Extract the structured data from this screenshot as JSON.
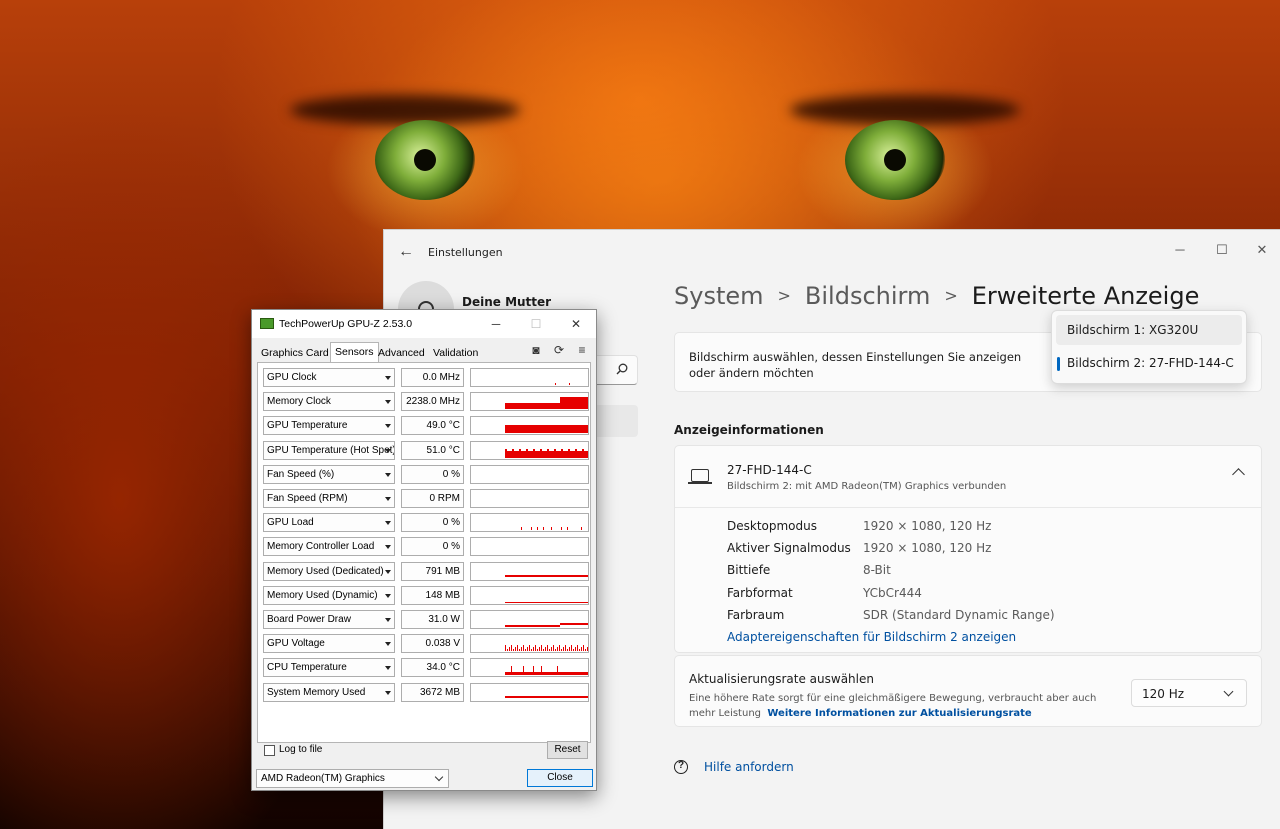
{
  "settings": {
    "app_title": "Einstellungen",
    "user_name": "Deine Mutter",
    "breadcrumb": [
      "System",
      "Bildschirm",
      "Erweiterte Anzeige"
    ],
    "select_card_text": "Bildschirm auswählen, dessen Einstellungen Sie anzeigen oder ändern möchten",
    "monitor_options": [
      "Bildschirm 1: XG320U",
      "Bildschirm 2: 27-FHD-144-C"
    ],
    "selected_monitor_index": 1,
    "section_title": "Anzeigeinformationen",
    "display": {
      "name": "27-FHD-144-C",
      "subtitle": "Bildschirm 2: mit AMD Radeon(TM) Graphics verbunden",
      "properties": [
        {
          "key": "Desktopmodus",
          "value": "1920 × 1080, 120 Hz"
        },
        {
          "key": "Aktiver Signalmodus",
          "value": "1920 × 1080, 120 Hz"
        },
        {
          "key": "Bittiefe",
          "value": "8-Bit"
        },
        {
          "key": "Farbformat",
          "value": "YCbCr444"
        },
        {
          "key": "Farbraum",
          "value": "SDR (Standard Dynamic Range)"
        }
      ],
      "adapter_link": "Adaptereigenschaften für Bildschirm 2 anzeigen"
    },
    "refresh": {
      "title": "Aktualisierungsrate auswählen",
      "description": "Eine höhere Rate sorgt für eine gleichmäßigere Bewegung, verbraucht aber auch mehr Leistung",
      "link": "Weitere Informationen zur Aktualisierungsrate",
      "value": "120 Hz"
    },
    "help_link": "Hilfe anfordern",
    "window_controls": {
      "minimize": "─",
      "maximize": "☐",
      "close": "✕"
    }
  },
  "gpuz": {
    "title": "TechPowerUp GPU-Z 2.53.0",
    "tabs": [
      "Graphics Card",
      "Sensors",
      "Advanced",
      "Validation"
    ],
    "active_tab": "Sensors",
    "sensors": [
      {
        "name": "GPU Clock",
        "value": "0.0 MHz",
        "graph": "sparse"
      },
      {
        "name": "Memory Clock",
        "value": "2238.0 MHz",
        "graph": "step-high"
      },
      {
        "name": "GPU Temperature",
        "value": "49.0 °C",
        "graph": "block"
      },
      {
        "name": "GPU Temperature (Hot Spot)",
        "value": "51.0 °C",
        "graph": "block-noisy"
      },
      {
        "name": "Fan Speed (%)",
        "value": "0 %",
        "graph": "none"
      },
      {
        "name": "Fan Speed (RPM)",
        "value": "0 RPM",
        "graph": "none"
      },
      {
        "name": "GPU Load",
        "value": "0 %",
        "graph": "spikes-small"
      },
      {
        "name": "Memory Controller Load",
        "value": "0 %",
        "graph": "none"
      },
      {
        "name": "Memory Used (Dedicated)",
        "value": "791 MB",
        "graph": "line-mid"
      },
      {
        "name": "Memory Used (Dynamic)",
        "value": "148 MB",
        "graph": "line-low"
      },
      {
        "name": "Board Power Draw",
        "value": "31.0 W",
        "graph": "line-step"
      },
      {
        "name": "GPU Voltage",
        "value": "0.038 V",
        "graph": "noisy"
      },
      {
        "name": "CPU Temperature",
        "value": "34.0 °C",
        "graph": "spikes"
      },
      {
        "name": "System Memory Used",
        "value": "3672 MB",
        "graph": "line-mid"
      }
    ],
    "log_to_file": "Log to file",
    "reset": "Reset",
    "device": "AMD Radeon(TM) Graphics",
    "close": "Close",
    "window_controls": {
      "minimize": "─",
      "maximize": "☐",
      "close": "✕"
    }
  }
}
